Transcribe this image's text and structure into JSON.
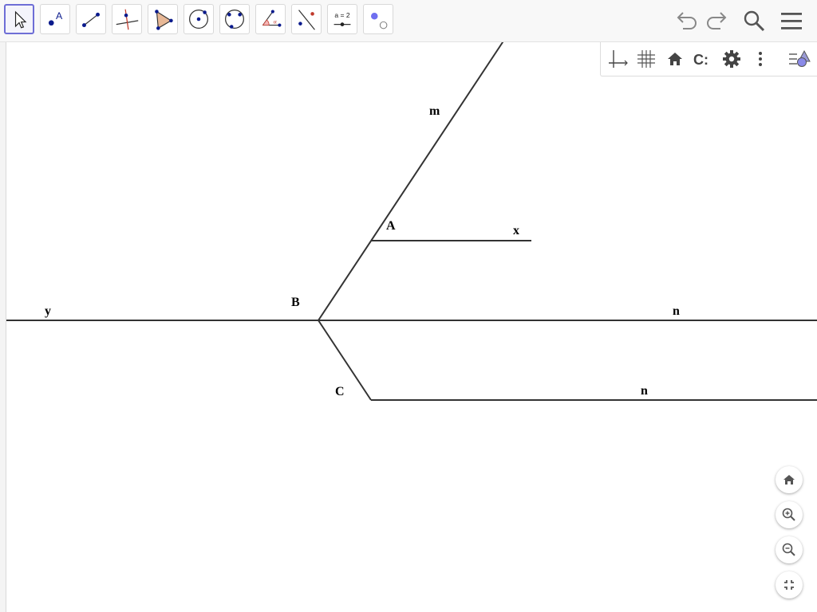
{
  "toolbar": {
    "tools": [
      {
        "name": "move-tool",
        "selected": true
      },
      {
        "name": "point-tool",
        "selected": false,
        "text": "A"
      },
      {
        "name": "segment-tool",
        "selected": false
      },
      {
        "name": "perpendicular-line-tool",
        "selected": false
      },
      {
        "name": "polygon-tool",
        "selected": false
      },
      {
        "name": "circle-center-point-tool",
        "selected": false
      },
      {
        "name": "conic-through-points-tool",
        "selected": false
      },
      {
        "name": "angle-tool",
        "selected": false,
        "text": "α"
      },
      {
        "name": "reflect-tool",
        "selected": false
      },
      {
        "name": "slider-tool",
        "selected": false,
        "text": "a = 2"
      },
      {
        "name": "show-hide-object-tool",
        "selected": false
      }
    ],
    "right_icons": [
      "undo-icon",
      "redo-icon",
      "search-icon",
      "menu-icon"
    ]
  },
  "style_bar": {
    "buttons": [
      "axes-toggle-icon",
      "grid-toggle-icon",
      "standard-view-icon",
      "point-capturing-icon",
      "settings-icon",
      "more-options-icon",
      "toggle-style-bar-icon"
    ],
    "capturing_text": "C:"
  },
  "zoom_controls": [
    "home-icon",
    "zoom-in-icon",
    "zoom-out-icon",
    "fullscreen-exit-icon"
  ],
  "construction": {
    "points": [
      "A",
      "B",
      "C"
    ],
    "lines": {
      "m": "m",
      "x": "x",
      "y": "y",
      "n_upper": "n",
      "n_lower": "n"
    }
  },
  "colors": {
    "line": "#333333",
    "selection": "#6e6ed6",
    "point_blue": "#0a1a8c"
  }
}
